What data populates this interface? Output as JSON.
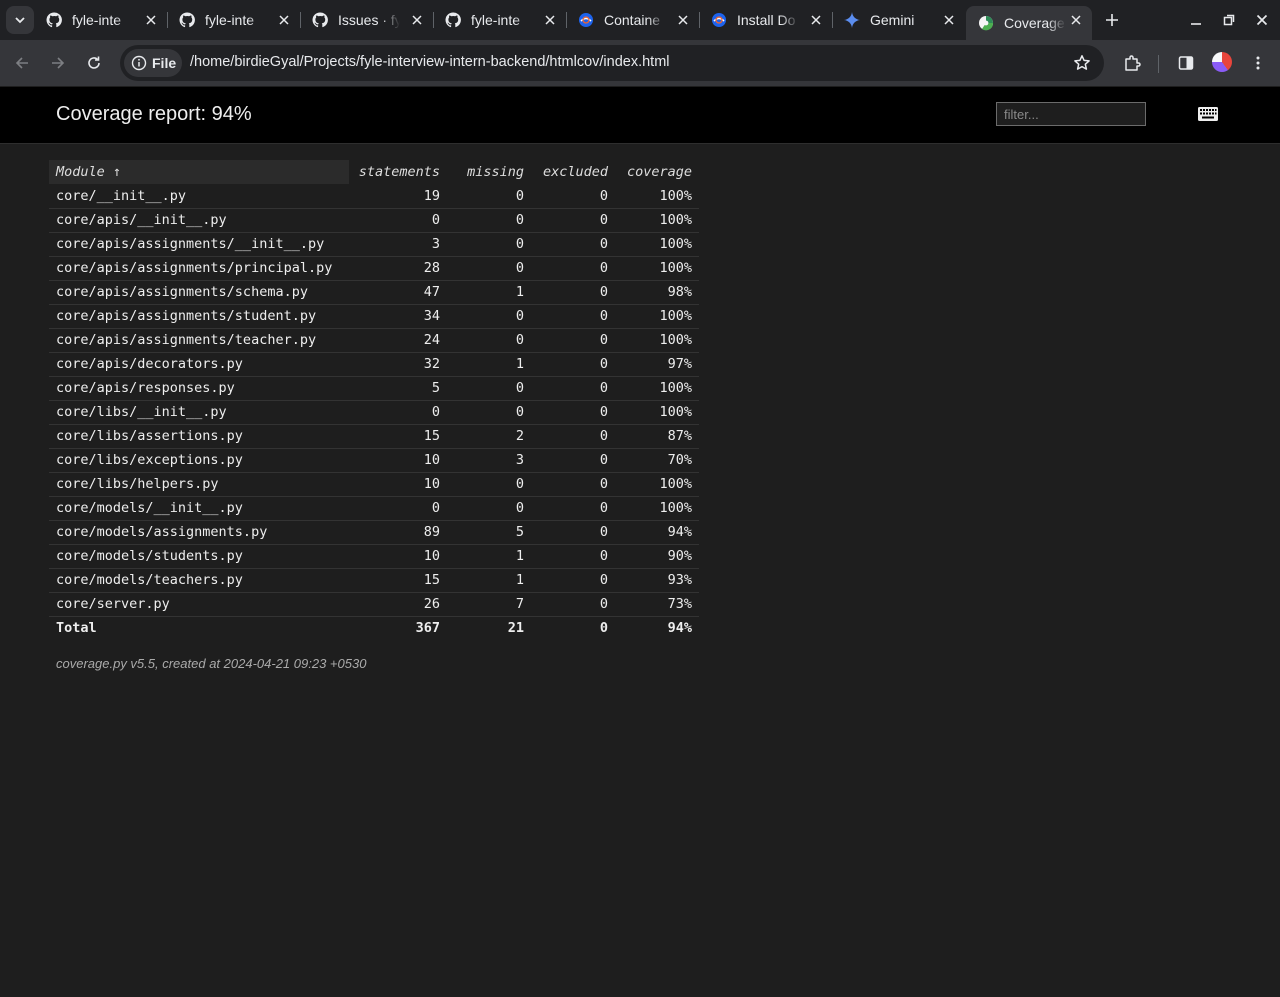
{
  "browser": {
    "tabs": [
      {
        "title": "fyle-inte",
        "icon": "github-icon"
      },
      {
        "title": "fyle-inte",
        "icon": "github-icon"
      },
      {
        "title": "Issues · fy",
        "icon": "github-icon"
      },
      {
        "title": "fyle-inte",
        "icon": "github-icon"
      },
      {
        "title": "Containe",
        "icon": "docker-icon"
      },
      {
        "title": "Install Do",
        "icon": "docker-icon"
      },
      {
        "title": "Gemini",
        "icon": "gemini-icon"
      },
      {
        "title": "Coverage",
        "icon": "coverage-icon",
        "active": true
      }
    ],
    "address": {
      "chip_label": "File",
      "url": "/home/birdieGyal/Projects/fyle-interview-intern-backend/htmlcov/index.html"
    }
  },
  "page": {
    "title": "Coverage report: 94%",
    "filter_placeholder": "filter...",
    "columns": {
      "module": "Module ↑",
      "statements": "statements",
      "missing": "missing",
      "excluded": "excluded",
      "coverage": "coverage"
    },
    "rows": [
      {
        "module": "core/__init__.py",
        "statements": "19",
        "missing": "0",
        "excluded": "0",
        "coverage": "100%"
      },
      {
        "module": "core/apis/__init__.py",
        "statements": "0",
        "missing": "0",
        "excluded": "0",
        "coverage": "100%"
      },
      {
        "module": "core/apis/assignments/__init__.py",
        "statements": "3",
        "missing": "0",
        "excluded": "0",
        "coverage": "100%"
      },
      {
        "module": "core/apis/assignments/principal.py",
        "statements": "28",
        "missing": "0",
        "excluded": "0",
        "coverage": "100%"
      },
      {
        "module": "core/apis/assignments/schema.py",
        "statements": "47",
        "missing": "1",
        "excluded": "0",
        "coverage": "98%"
      },
      {
        "module": "core/apis/assignments/student.py",
        "statements": "34",
        "missing": "0",
        "excluded": "0",
        "coverage": "100%"
      },
      {
        "module": "core/apis/assignments/teacher.py",
        "statements": "24",
        "missing": "0",
        "excluded": "0",
        "coverage": "100%"
      },
      {
        "module": "core/apis/decorators.py",
        "statements": "32",
        "missing": "1",
        "excluded": "0",
        "coverage": "97%"
      },
      {
        "module": "core/apis/responses.py",
        "statements": "5",
        "missing": "0",
        "excluded": "0",
        "coverage": "100%"
      },
      {
        "module": "core/libs/__init__.py",
        "statements": "0",
        "missing": "0",
        "excluded": "0",
        "coverage": "100%"
      },
      {
        "module": "core/libs/assertions.py",
        "statements": "15",
        "missing": "2",
        "excluded": "0",
        "coverage": "87%"
      },
      {
        "module": "core/libs/exceptions.py",
        "statements": "10",
        "missing": "3",
        "excluded": "0",
        "coverage": "70%"
      },
      {
        "module": "core/libs/helpers.py",
        "statements": "10",
        "missing": "0",
        "excluded": "0",
        "coverage": "100%"
      },
      {
        "module": "core/models/__init__.py",
        "statements": "0",
        "missing": "0",
        "excluded": "0",
        "coverage": "100%"
      },
      {
        "module": "core/models/assignments.py",
        "statements": "89",
        "missing": "5",
        "excluded": "0",
        "coverage": "94%"
      },
      {
        "module": "core/models/students.py",
        "statements": "10",
        "missing": "1",
        "excluded": "0",
        "coverage": "90%"
      },
      {
        "module": "core/models/teachers.py",
        "statements": "15",
        "missing": "1",
        "excluded": "0",
        "coverage": "93%"
      },
      {
        "module": "core/server.py",
        "statements": "26",
        "missing": "7",
        "excluded": "0",
        "coverage": "73%"
      }
    ],
    "total": {
      "module": "Total",
      "statements": "367",
      "missing": "21",
      "excluded": "0",
      "coverage": "94%"
    },
    "footer": "coverage.py v5.5, created at 2024-04-21 09:23 +0530"
  }
}
